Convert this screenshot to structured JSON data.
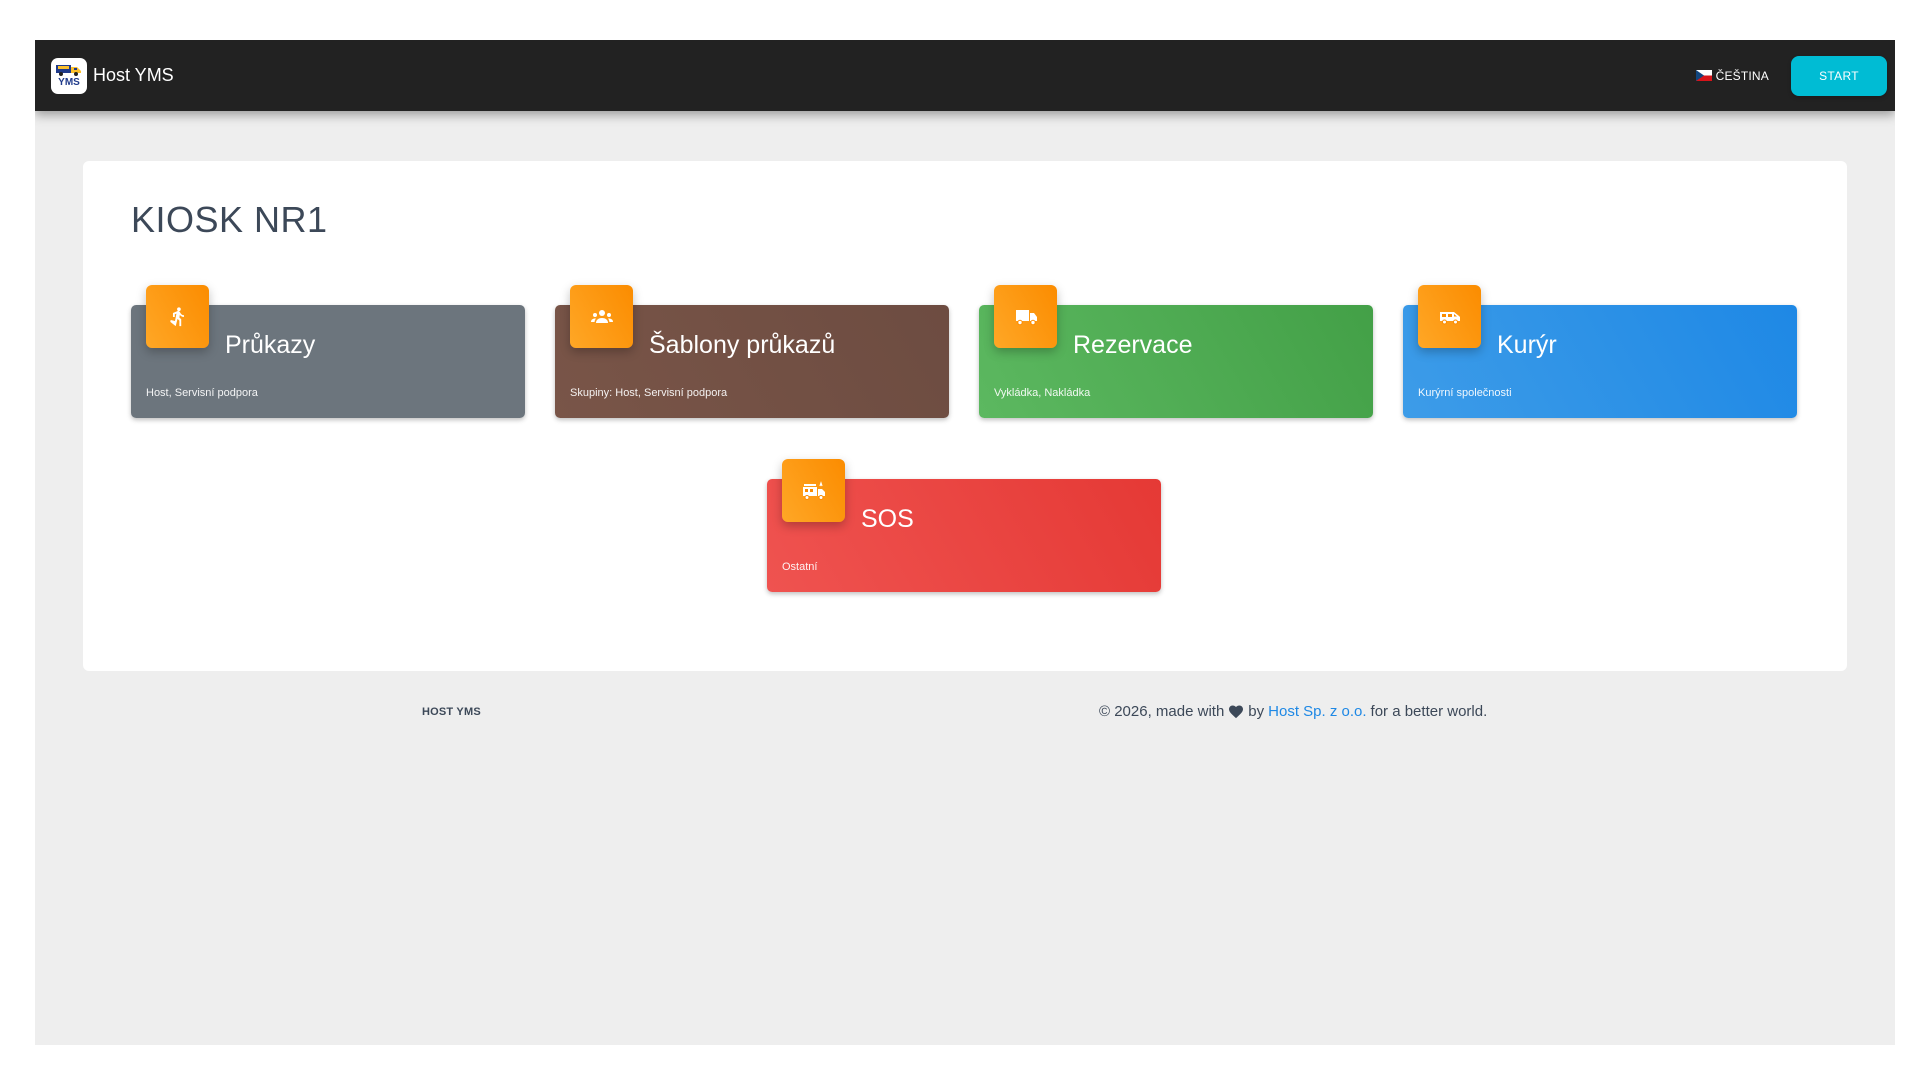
{
  "navbar": {
    "brand_label": "Host YMS",
    "logo_text": "YMS",
    "language_label": "ČEŠTINA",
    "start_label": "START"
  },
  "page": {
    "title": "KIOSK NR1"
  },
  "tiles": [
    {
      "title": "Průkazy",
      "subtitle": "Host, Servisní podpora",
      "icon": "pedestrian-icon",
      "color_from": "#6c757d",
      "color_to": "#6c757d"
    },
    {
      "title": "Šablony průkazů",
      "subtitle": "Skupiny: Host, Servisní podpora",
      "icon": "group-icon",
      "color_from": "#795548",
      "color_to": "#6d4c41"
    },
    {
      "title": "Rezervace",
      "subtitle": "Vykládka, Nakládka",
      "icon": "truck-icon",
      "color_from": "#5cb860",
      "color_to": "#43a047"
    },
    {
      "title": "Kurýr",
      "subtitle": "Kurýrní společnosti",
      "icon": "van-icon",
      "color_from": "#3d9ce8",
      "color_to": "#1e88e5"
    },
    {
      "title": "SOS",
      "subtitle": "Ostatní",
      "icon": "fire-truck-icon",
      "color_from": "#ef5350",
      "color_to": "#e53935"
    }
  ],
  "footer": {
    "brand": "HOST YMS",
    "copy_prefix": "© 2026, made with",
    "copy_by": "by",
    "company_link": "Host Sp. z o.o.",
    "copy_suffix": "for a better world."
  }
}
